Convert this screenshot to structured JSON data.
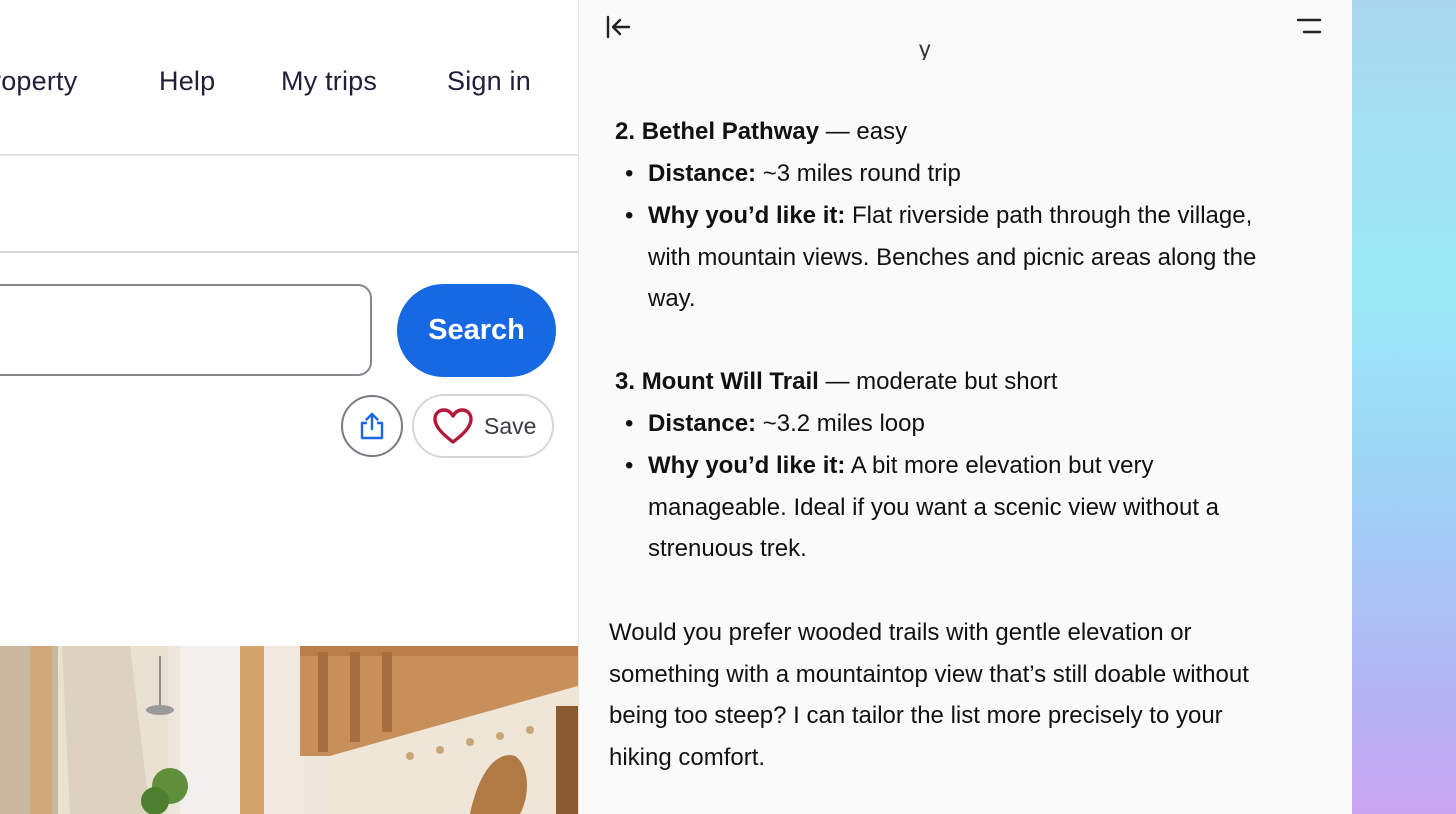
{
  "nav": {
    "list_property": "roperty",
    "help": "Help",
    "my_trips": "My trips",
    "sign_in": "Sign in"
  },
  "search": {
    "button_label": "Search",
    "input_value": ""
  },
  "actions": {
    "save_label": "Save"
  },
  "panel": {
    "cut_text": "y",
    "trails": [
      {
        "number": "2.",
        "name": "Bethel Pathway",
        "difficulty": "— easy",
        "distance_label": "Distance:",
        "distance_value": "~3 miles round trip",
        "why_label": "Why you’d like it:",
        "why_text": "Flat riverside path through the village, with mountain views. Benches and picnic areas along the way."
      },
      {
        "number": "3.",
        "name": "Mount Will Trail",
        "difficulty": "— moderate but short",
        "distance_label": "Distance:",
        "distance_value": "~3.2 miles loop",
        "why_label": "Why you’d like it:",
        "why_text": "A bit more elevation but very manageable. Ideal if you want a scenic view without a strenuous trek."
      }
    ],
    "closing": "Would you prefer wooded trails with gentle elevation or something with a mountaintop view that’s still doable without being too steep? I can tailor the list more precisely to your hiking comfort."
  },
  "colors": {
    "search_button": "#1668e3",
    "heart": "#b3173a",
    "share_icon": "#1668e3"
  }
}
